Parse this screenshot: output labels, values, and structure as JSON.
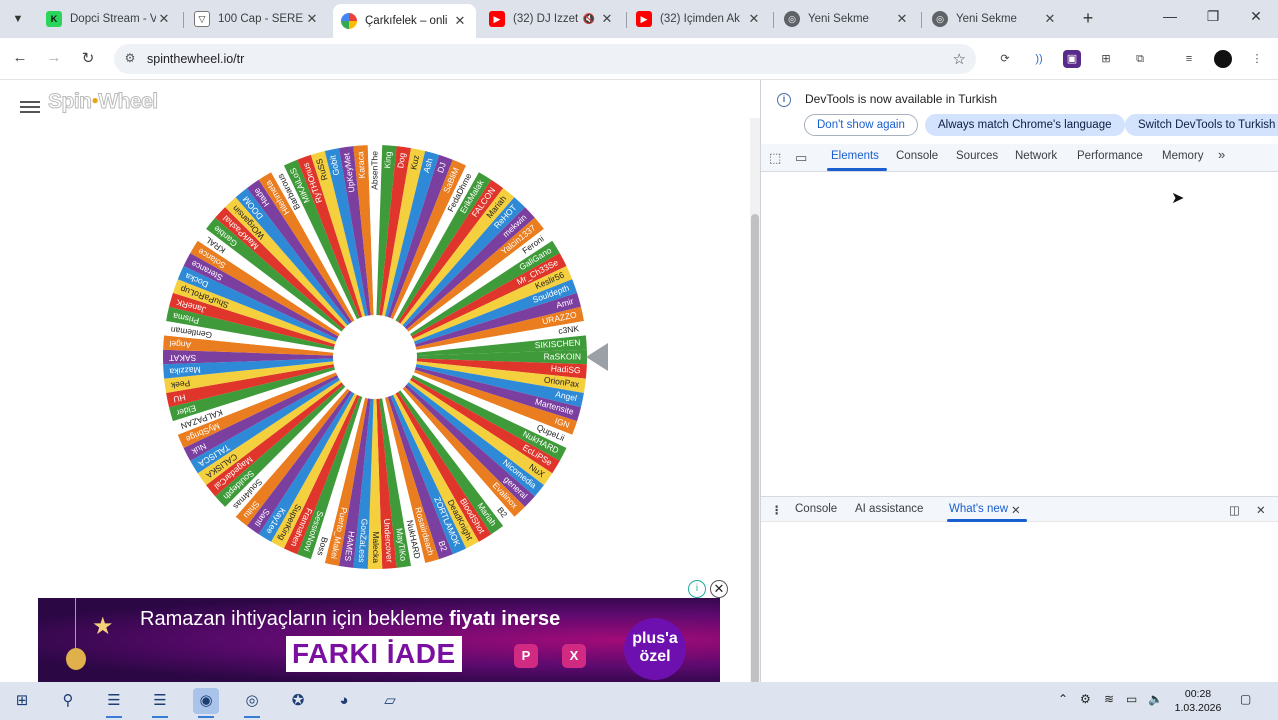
{
  "tabs": [
    {
      "title": "Dopci Stream - V",
      "favicon": "kick-icon",
      "color": "#2bd45a",
      "fav_text": "K"
    },
    {
      "title": "100 Cap - SEREN",
      "favicon": "v-icon",
      "color": "#ffffff",
      "fav_text": "▽"
    },
    {
      "title": "Çarkıfelek – onli",
      "favicon": "wheel-icon",
      "color": "#ea4335",
      "fav_text": ""
    },
    {
      "title": "(32) DJ İzzet",
      "favicon": "youtube-icon",
      "color": "#ff0000",
      "fav_text": "▶"
    },
    {
      "title": "(32) İçimden Ak",
      "favicon": "youtube-icon",
      "color": "#ff0000",
      "fav_text": "▶"
    },
    {
      "title": "Yeni Sekme",
      "favicon": "chrome-icon",
      "color": "#5f6368",
      "fav_text": "◎"
    },
    {
      "title": "Yeni Sekme",
      "favicon": "chrome-icon",
      "color": "#5f6368",
      "fav_text": "◎"
    }
  ],
  "tab_close": "✕",
  "new_tab": "+",
  "address": {
    "url": "spinthewheel.io/tr"
  },
  "page": {
    "logo": "Spin",
    "logo_tail": "Wheel",
    "wheel_entries": [
      "RaSKOIN",
      "HadiSG",
      "OrionPax",
      "Angel",
      "Martensite",
      "IGN",
      "QupeLii",
      "NukHARD",
      "EcLiPSe",
      "NuX",
      "Nicomedia",
      "general",
      "Evalinox",
      "B2",
      "Mariah",
      "BloodShot",
      "DeadKnight",
      "ZORTLAMOK",
      "B2",
      "Rosaiirdeach",
      "NukHARD",
      "MayTiKo",
      "Undercover",
      "Malecka",
      "GonZaLess",
      "HAMES",
      "Puerto_Makei",
      "Boss",
      "SessioNovi",
      "Frannahen",
      "SuperKing",
      "Kay1ee",
      "Santi",
      "Shitu",
      "Soul4mas",
      "Souldepth",
      "MagedarCal",
      "CALISKA",
      "TALISCA",
      "Nuk",
      "MySbrige",
      "KALPAZAN",
      "Elder",
      "HU",
      "Peek",
      "Mazzika",
      "SAKAT",
      "Angel",
      "Gentleman",
      "Prisma",
      "JaneRK",
      "ShuPaRoLup",
      "Docka",
      "Sterance",
      "Solance",
      "KRAL",
      "Ganbie",
      "MarkPashaI",
      "WOrgansin",
      "DOOM",
      "Hade",
      "Hilehmeta",
      "Barbarous",
      "MiKAiLoS",
      "RyTHOnus",
      "RuSS",
      "Gobit",
      "UpKeyMet",
      "Karaca",
      "AbsenThe",
      "King",
      "Dog",
      "Kuz",
      "Ash",
      "DJ",
      "SaBliM",
      "FedaDhme",
      "ErikMalak",
      "FALCON",
      "Mariah",
      "ReHOT",
      "mekwin",
      "Yalcin1337",
      "Feroni",
      "GaliGano",
      "Mr_Ch33Se",
      "Keslir56",
      "Souldepth",
      "Amir",
      "URAZZO",
      "c3NK",
      "SIKISCHEN"
    ],
    "wheel_colors": [
      "#3f9b3a",
      "#e0352b",
      "#f4d03f",
      "#2e8ad6",
      "#7b3fa0",
      "#ea7d1f",
      "#ffffff"
    ]
  },
  "ad": {
    "line1_pre": "Ramazan ihtiyaçların için bekleme ",
    "line1_bold": "fiyatı inerse",
    "line2": "FARKI İADE",
    "badge_line1": "plus'a",
    "badge_line2": "özel",
    "logo1": "P",
    "logo2": "X"
  },
  "devtools": {
    "info": "DevTools is now available in Turkish",
    "btn_dont_show": "Don't show again",
    "btn_always_match": "Always match Chrome's language",
    "btn_switch": "Switch DevTools to Turkish",
    "tabs": [
      "Elements",
      "Console",
      "Sources",
      "Network",
      "Performance",
      "Memory"
    ],
    "more": "»",
    "drawer_tabs": [
      "Console",
      "AI assistance",
      "What's new"
    ]
  },
  "taskbar": {
    "time": "00:28",
    "date": "1.03.2026"
  }
}
